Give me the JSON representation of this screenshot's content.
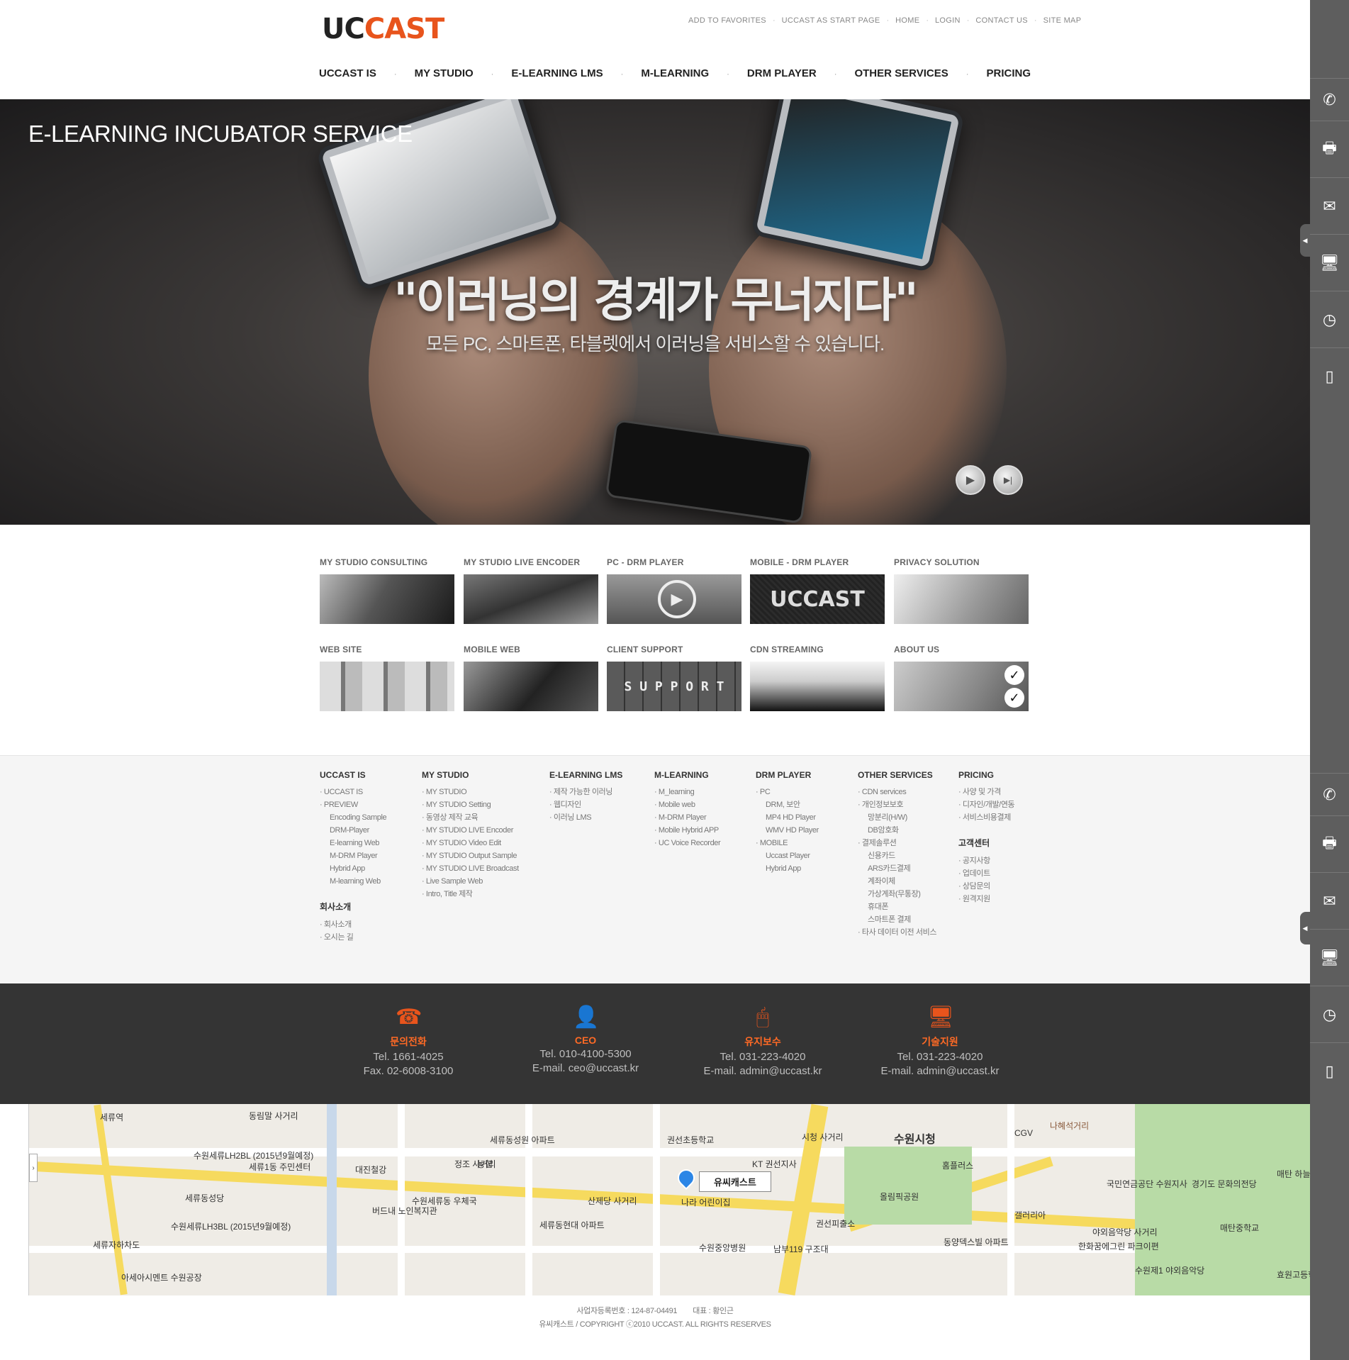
{
  "header": {
    "logo": {
      "part1": "UC",
      "part2": "CAST"
    },
    "util_nav": [
      "ADD TO FAVORITES",
      "UCCAST AS START PAGE",
      "HOME",
      "LOGIN",
      "CONTACT US",
      "SITE MAP"
    ],
    "util_sep": "·",
    "gnb": [
      "UCCAST IS",
      "MY STUDIO",
      "E-LEARNING LMS",
      "M-LEARNING",
      "DRM PLAYER",
      "OTHER SERVICES",
      "PRICING"
    ],
    "gnb_sep": "·"
  },
  "hero": {
    "title": "E-LEARNING INCUBATOR SERVICE",
    "headline": "\"이러닝의 경계가 무너지다\"",
    "subline": "모든 PC, 스마트폰, 타블렛에서 이러닝을 서비스할 수 있습니다.",
    "play_icon": "▶",
    "next_icon": "▶|"
  },
  "services": [
    {
      "label": "MY STUDIO CONSULTING"
    },
    {
      "label": "MY STUDIO LIVE ENCODER"
    },
    {
      "label": "PC - DRM PLAYER"
    },
    {
      "label": "MOBILE - DRM PLAYER",
      "thumb_text": "UCCAST"
    },
    {
      "label": "PRIVACY SOLUTION"
    },
    {
      "label": "WEB SITE"
    },
    {
      "label": "MOBILE WEB"
    },
    {
      "label": "CLIENT SUPPORT",
      "thumb_text": "S U P P O R T"
    },
    {
      "label": "CDN STREAMING"
    },
    {
      "label": "ABOUT US"
    }
  ],
  "sitemap": [
    {
      "heading": "UCCAST IS",
      "items": [
        {
          "t": "UCCAST IS",
          "lvl": 1
        },
        {
          "t": "PREVIEW",
          "lvl": 1
        },
        {
          "t": "Encoding Sample",
          "lvl": 2
        },
        {
          "t": "DRM-Player",
          "lvl": 2
        },
        {
          "t": "E-learning Web",
          "lvl": 2
        },
        {
          "t": "M-DRM Player",
          "lvl": 2
        },
        {
          "t": "Hybrid App",
          "lvl": 2
        },
        {
          "t": "M-learning Web",
          "lvl": 2
        }
      ],
      "heading2": "회사소개",
      "items2": [
        {
          "t": "회사소개",
          "lvl": 1
        },
        {
          "t": "오시는 길",
          "lvl": 1
        }
      ]
    },
    {
      "heading": "MY STUDIO",
      "items": [
        {
          "t": "MY STUDIO",
          "lvl": 1
        },
        {
          "t": "MY STUDIO Setting",
          "lvl": 1
        },
        {
          "t": "동영상 제작 교육",
          "lvl": 1
        },
        {
          "t": "MY STUDIO LIVE Encoder",
          "lvl": 1
        },
        {
          "t": "MY STUDIO Video Edit",
          "lvl": 1
        },
        {
          "t": "MY STUDIO Output Sample",
          "lvl": 1
        },
        {
          "t": "MY STUDIO LIVE Broadcast",
          "lvl": 1
        },
        {
          "t": "Live Sample Web",
          "lvl": 1
        },
        {
          "t": "Intro, Title 제작",
          "lvl": 1
        }
      ]
    },
    {
      "heading": "E-LEARNING LMS",
      "items": [
        {
          "t": "제작 가능한 이러닝",
          "lvl": 1
        },
        {
          "t": "웹디자인",
          "lvl": 1
        },
        {
          "t": "이러닝 LMS",
          "lvl": 1
        }
      ]
    },
    {
      "heading": "M-LEARNING",
      "items": [
        {
          "t": "M_learning",
          "lvl": 1
        },
        {
          "t": "Mobile web",
          "lvl": 1
        },
        {
          "t": "M-DRM Player",
          "lvl": 1
        },
        {
          "t": "Mobile Hybrid APP",
          "lvl": 1
        },
        {
          "t": "UC Voice Recorder",
          "lvl": 1
        }
      ]
    },
    {
      "heading": "DRM PLAYER",
      "items": [
        {
          "t": "PC",
          "lvl": 1
        },
        {
          "t": "DRM, 보안",
          "lvl": 2
        },
        {
          "t": "MP4 HD Player",
          "lvl": 2
        },
        {
          "t": "WMV HD Player",
          "lvl": 2
        },
        {
          "t": "MOBILE",
          "lvl": 1
        },
        {
          "t": "Uccast Player",
          "lvl": 2
        },
        {
          "t": "Hybrid App",
          "lvl": 2
        }
      ]
    },
    {
      "heading": "OTHER SERVICES",
      "items": [
        {
          "t": "CDN services",
          "lvl": 1
        },
        {
          "t": "개인정보보호",
          "lvl": 1
        },
        {
          "t": "망분리(H/W)",
          "lvl": 2
        },
        {
          "t": "DB암호화",
          "lvl": 2
        },
        {
          "t": "결제솔루션",
          "lvl": 1
        },
        {
          "t": "신용카드",
          "lvl": 2
        },
        {
          "t": "ARS카드결제",
          "lvl": 2
        },
        {
          "t": "계좌이체",
          "lvl": 2
        },
        {
          "t": "가상계좌(무통장)",
          "lvl": 2
        },
        {
          "t": "휴대폰",
          "lvl": 2
        },
        {
          "t": "스마트폰 결제",
          "lvl": 2
        },
        {
          "t": "타사 데이터 이전 서비스",
          "lvl": 1
        }
      ]
    },
    {
      "heading": "PRICING",
      "items": [
        {
          "t": "사양 및 가격",
          "lvl": 1
        },
        {
          "t": "디자인/개발/연동",
          "lvl": 1
        },
        {
          "t": "서비스비용결제",
          "lvl": 1
        }
      ],
      "heading2": "고객센터",
      "items2": [
        {
          "t": "공지사항",
          "lvl": 1
        },
        {
          "t": "업데이트",
          "lvl": 1
        },
        {
          "t": "상담문의",
          "lvl": 1
        },
        {
          "t": "원격지원",
          "lvl": 1
        }
      ]
    }
  ],
  "contact": [
    {
      "icon": "phone-question-icon",
      "glyph": "☎",
      "title": "문의전화",
      "line1": "Tel. 1661-4025",
      "line2": "Fax. 02-6008-3100"
    },
    {
      "icon": "ceo-person-icon",
      "glyph": "👤",
      "title": "CEO",
      "line1": "Tel. 010-4100-5300",
      "line2": "E-mail. ceo@uccast.kr"
    },
    {
      "icon": "mouse-icon",
      "glyph": "🖱",
      "title": "유지보수",
      "line1": "Tel. 031-223-4020",
      "line2": "E-mail. admin@uccast.kr"
    },
    {
      "icon": "monitor-support-icon",
      "glyph": "🖥",
      "title": "기술지원",
      "line1": "Tel. 031-223-4020",
      "line2": "E-mail. admin@uccast.kr"
    }
  ],
  "map": {
    "marker_label": "유씨캐스트",
    "toggle": "›",
    "labels": [
      "동림말 사거리",
      "수원세류LH2BL (2015년9월예정)",
      "세류1동 주민센터",
      "세류동성당",
      "수원세류LH3BL (2015년9월예정)",
      "대진철강",
      "버드내 노인복지관",
      "수원세류동 우체국",
      "정조 사거리",
      "농협",
      "세류동성원 아파트",
      "세류동현대 아파트",
      "산제당 사거리",
      "권선초등학교",
      "나라 어린이집",
      "수원중앙병원",
      "시청 사거리",
      "KT 권선지사",
      "권선피출소",
      "남부119 구조대",
      "수원시청",
      "홈플러스",
      "올림픽공원",
      "동양덱스빌 아파트",
      "갤러리아",
      "CGV",
      "나혜석거리",
      "국민연금공단 수원지사",
      "경기도 문화의전당",
      "야외음악당 사거리",
      "한화꿈에그린 파크이편",
      "매탄중학교",
      "효원고등학교",
      "매탄 하늘채",
      "아세아시멘트 수원공장",
      "세류역",
      "세류자하차도",
      "수원제1 야외음악당"
    ]
  },
  "copyright": {
    "line1": "사업자등록번호 : 124-87-04491        대표 : 황인근",
    "line2": "유씨캐스트 / COPYRIGHT ⓒ2010 UCCAST. ALL RIGHTS RESERVES"
  },
  "quickbar": {
    "top": [
      "phone-icon",
      "fax-icon",
      "mail-icon",
      "monitor-icon",
      "clock-icon",
      "mobile-icon"
    ],
    "bottom": [
      "phone-icon",
      "fax-icon",
      "mail-icon",
      "monitor-icon",
      "clock-icon",
      "mobile-icon"
    ],
    "glyphs": {
      "phone-icon": "✆",
      "fax-icon": "🖶",
      "mail-icon": "✉",
      "monitor-icon": "🖥",
      "clock-icon": "◷",
      "mobile-icon": "▯"
    },
    "tab_glyph": "◀"
  }
}
